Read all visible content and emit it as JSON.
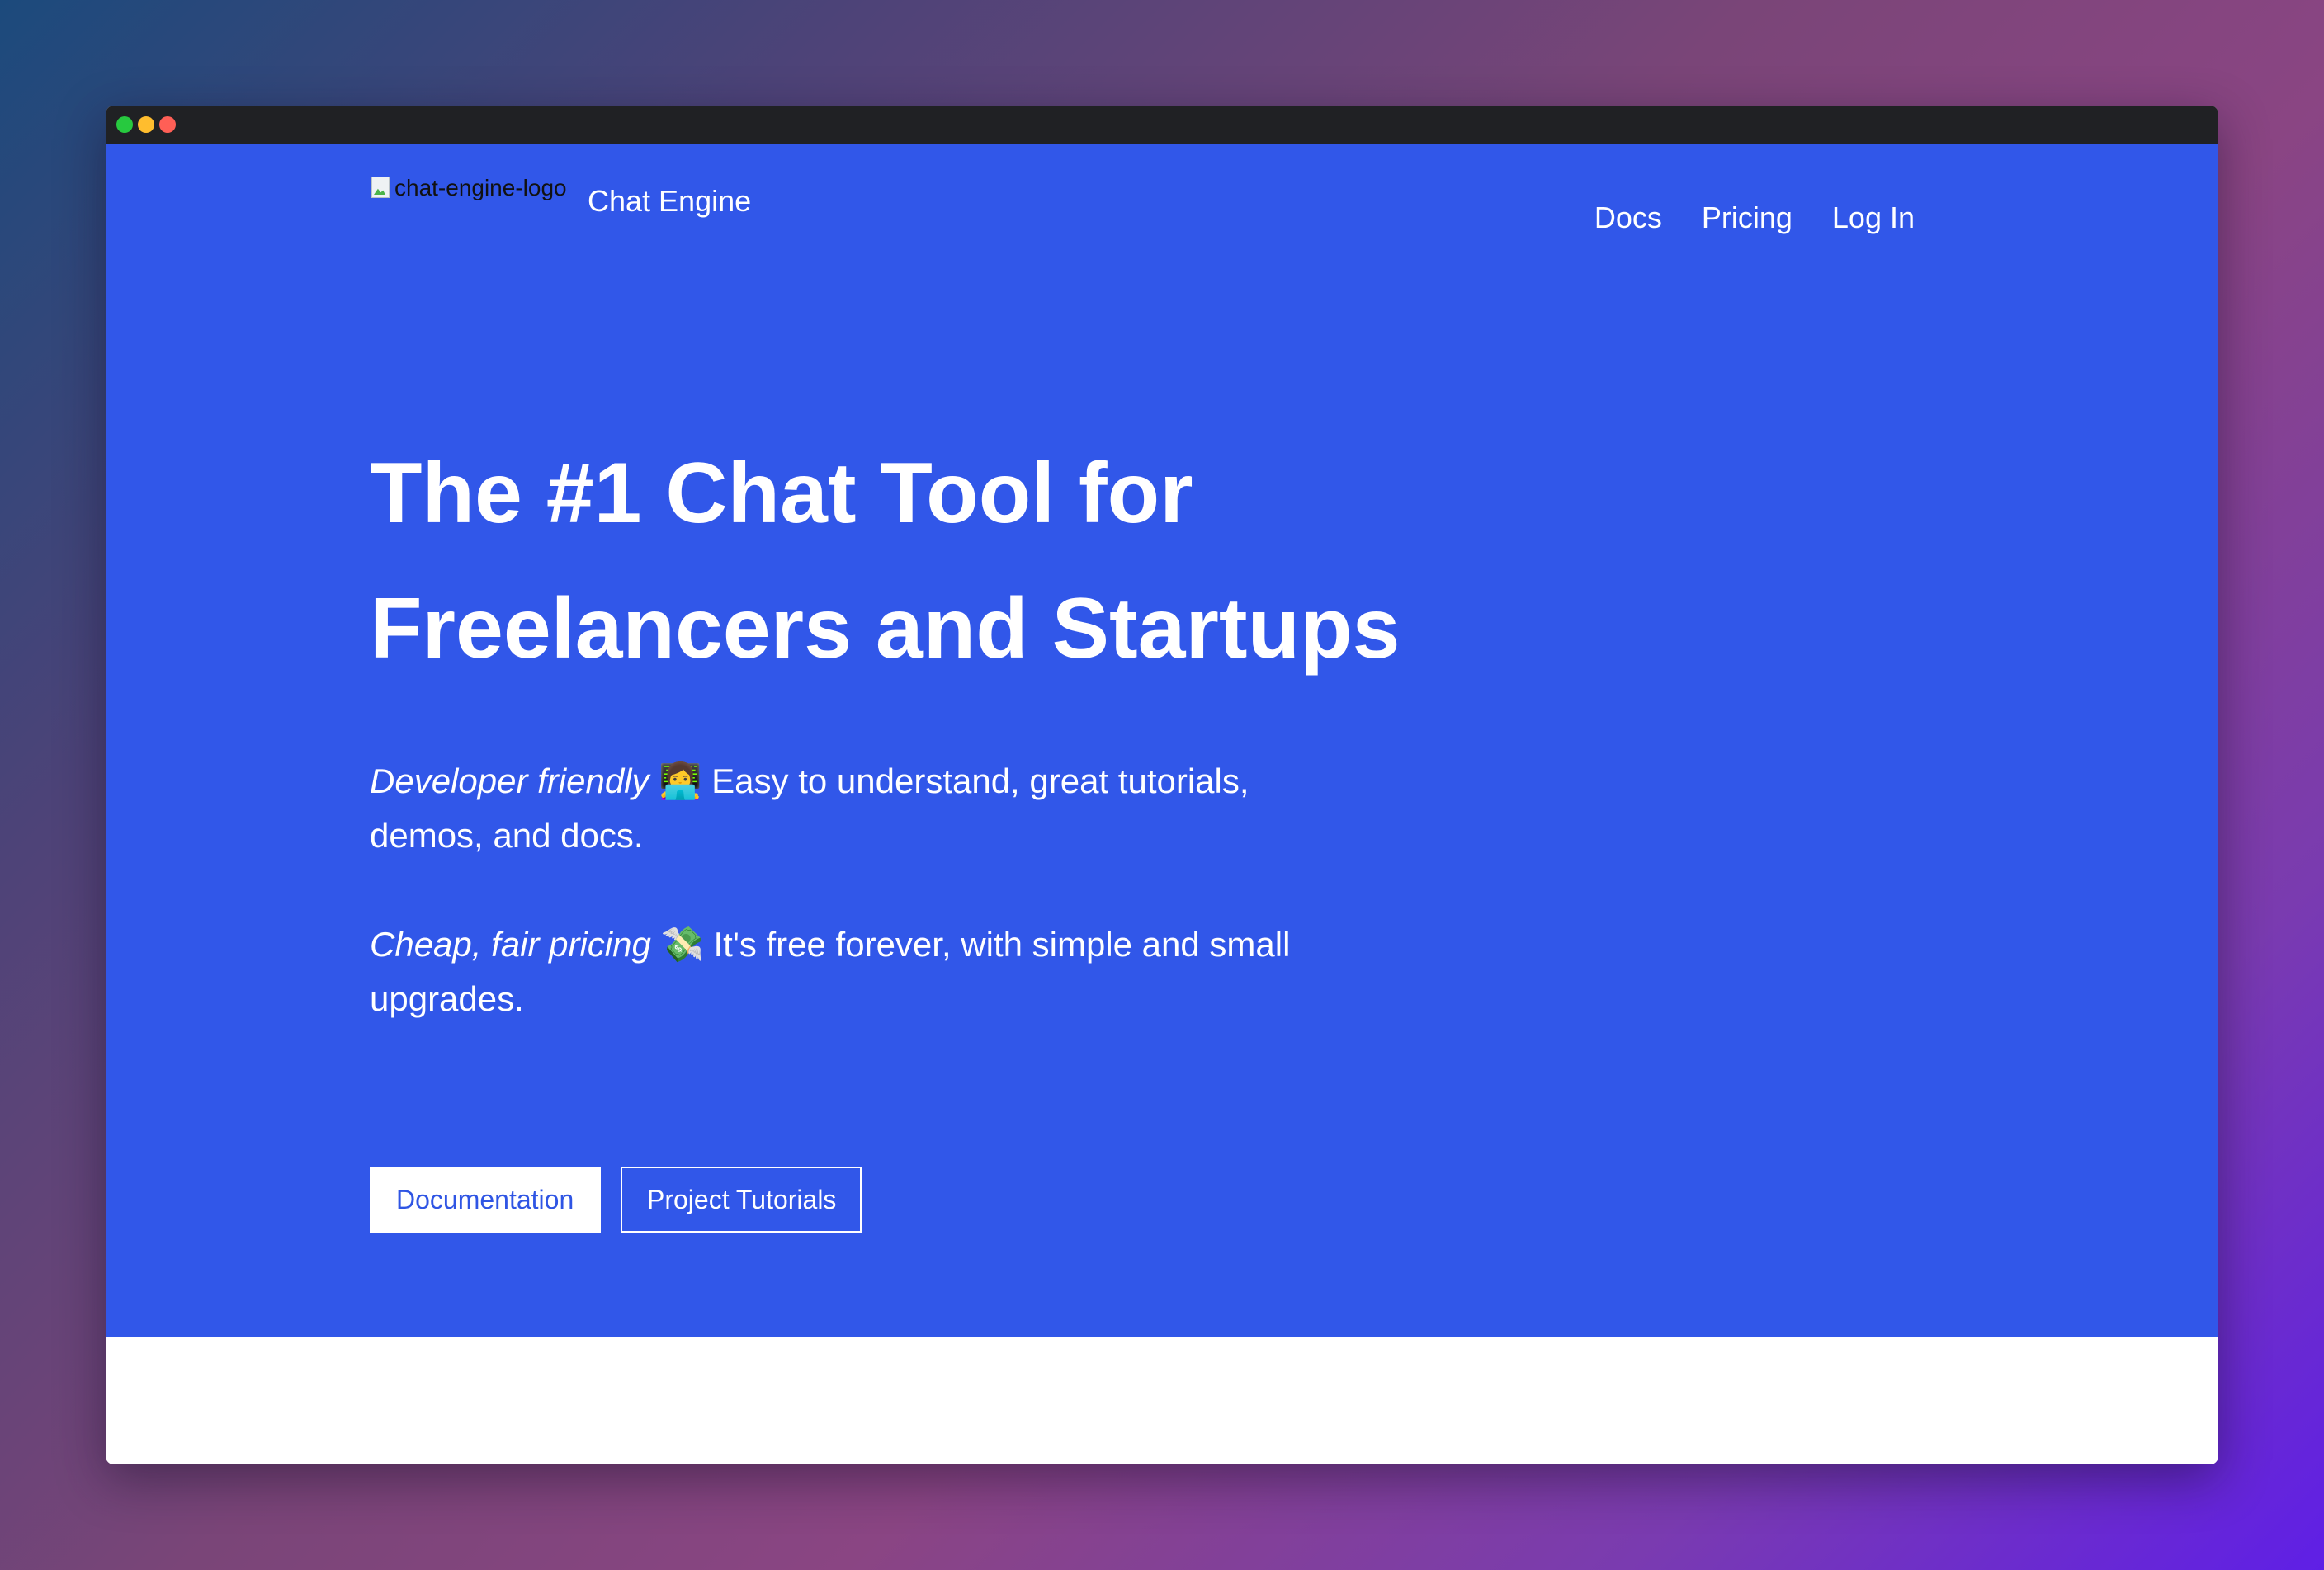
{
  "window": {
    "controls": [
      "green",
      "yellow",
      "red"
    ]
  },
  "header": {
    "logo_alt": "chat-engine-logo",
    "brand_name": "Chat Engine",
    "nav": [
      {
        "label": "Docs"
      },
      {
        "label": "Pricing"
      },
      {
        "label": "Log In"
      }
    ]
  },
  "hero": {
    "title_line1": "The #1 Chat Tool for",
    "title_line2": "Freelancers and Startups",
    "feature1_emphasis": "Developer friendly",
    "feature1_glyph": "👩‍💻",
    "feature1_text": "Easy to understand, great tutorials, demos, and docs.",
    "feature2_emphasis": "Cheap, fair pricing",
    "feature2_glyph": "💸",
    "feature2_text": "It's free forever, with simple and small upgrades.",
    "primary_button": "Documentation",
    "secondary_button": "Project Tutorials"
  },
  "colors": {
    "hero_background": "#3157e9",
    "titlebar": "#202124",
    "primary_button_text": "#2f55e4"
  }
}
